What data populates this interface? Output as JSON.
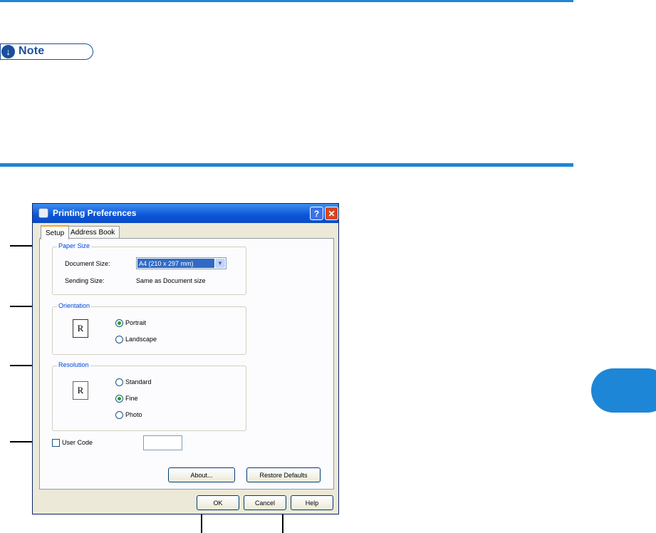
{
  "note": {
    "label": "Note"
  },
  "dialog": {
    "title": "Printing Preferences",
    "help_glyph": "?",
    "close_glyph": "✕",
    "tabs": [
      {
        "label": "Setup",
        "active": true
      },
      {
        "label": "Address Book",
        "active": false
      }
    ],
    "paper_size": {
      "group_title": "Paper Size",
      "document_size_label": "Document Size:",
      "document_size_value": "A4 (210 x 297 mm)",
      "sending_size_label": "Sending Size:",
      "sending_size_value": "Same as Document size"
    },
    "orientation": {
      "group_title": "Orientation",
      "preview_letter": "R",
      "options": [
        {
          "label": "Portrait",
          "checked": true
        },
        {
          "label": "Landscape",
          "checked": false
        }
      ]
    },
    "resolution": {
      "group_title": "Resolution",
      "preview_letter": "R",
      "options": [
        {
          "label": "Standard",
          "checked": false
        },
        {
          "label": "Fine",
          "checked": true
        },
        {
          "label": "Photo",
          "checked": false
        }
      ]
    },
    "user_code": {
      "label": "User Code",
      "checked": false,
      "value": ""
    },
    "buttons": {
      "about": "About...",
      "restore_defaults": "Restore Defaults",
      "ok": "OK",
      "cancel": "Cancel",
      "help": "Help"
    }
  },
  "colors": {
    "accent_rule": "#1e86d6",
    "note_blue": "#1a4f9c",
    "titlebar": "#0b55d8"
  }
}
